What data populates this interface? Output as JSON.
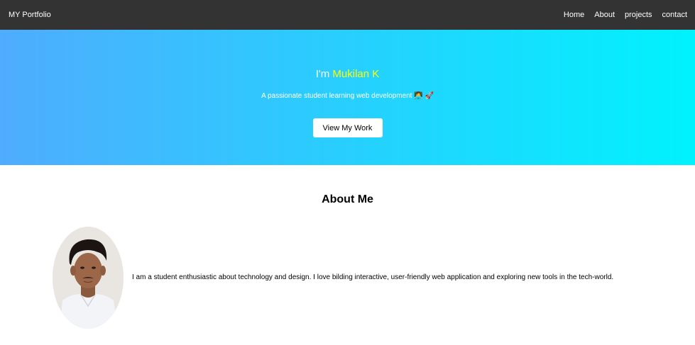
{
  "navbar": {
    "brand": "MY Portfolio",
    "links": [
      "Home",
      "About",
      "projects",
      "contact"
    ]
  },
  "hero": {
    "greeting": "I'm ",
    "name": "Mukilan K",
    "subtitle": "A passionate student learning web development",
    "subtitle_emoji": "👩‍💻 🚀",
    "cta_label": "View My Work"
  },
  "about": {
    "title": "About Me",
    "text": "I am a student enthusiastic about technology and design. I love bilding interactive, user-friendly web application and exploring new tools in the tech-world."
  },
  "colors": {
    "navbar_bg": "#333333",
    "hero_gradient_start": "#4facfe",
    "hero_gradient_end": "#00f2fe",
    "name_highlight": "#ffff00"
  }
}
